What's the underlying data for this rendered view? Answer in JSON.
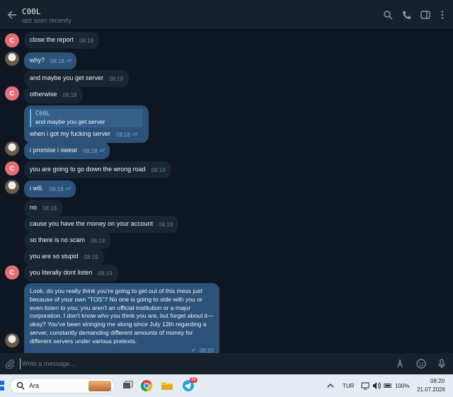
{
  "header": {
    "title": "C00L",
    "status": "last seen recently"
  },
  "messages": [
    {
      "text": "close the report",
      "time": "08:18",
      "sender": "C"
    },
    {
      "text": "why?",
      "time": "08:18",
      "sender": "me",
      "read": "✓✓"
    },
    {
      "text": "and maybe you get server",
      "time": "08:18",
      "sender": "C"
    },
    {
      "text": "otherwise",
      "time": "08:18",
      "sender": "C"
    },
    {
      "quote_name": "C00L",
      "quote_text": "and maybe you get server",
      "text": "when i got my fucking server",
      "time": "08:18",
      "sender": "me",
      "read": "✓✓"
    },
    {
      "text": "i promise i swear",
      "time": "08:18",
      "sender": "me",
      "read": "✓✓"
    },
    {
      "text": "you are going to go down the wrong road",
      "time": "08:18",
      "sender": "C"
    },
    {
      "text": "i will.",
      "time": "08:18",
      "sender": "me",
      "read": "✓✓"
    },
    {
      "text": "no",
      "time": "08:18",
      "sender": "C"
    },
    {
      "text": "cause you have the money on your account",
      "time": "08:18",
      "sender": "C"
    },
    {
      "text": "so there is no scam",
      "time": "08:19",
      "sender": "C"
    },
    {
      "text": "you are so stupid",
      "time": "08:19",
      "sender": "C"
    },
    {
      "text": "you literally dont listen",
      "time": "08:19",
      "sender": "C"
    },
    {
      "text": "Look, do you really think you're going to get out of this mess just because of your own \"TOS\"? No one is going to side with you or even listen to you; you aren't an official institution or a major corporation. I don't know who you think you are, but forget about it—okay? You've been stringing me along since July 13th regarding a server, constantly demanding different amounts of money for different servers under various pretexts.",
      "time": "08:20",
      "sender": "me",
      "read": "✓"
    }
  ],
  "avatar_letter": "C",
  "input": {
    "placeholder": "Write a message..."
  },
  "taskbar": {
    "search_label": "Ara",
    "telegram_badge": "39",
    "language": "TUR",
    "battery": "100%",
    "time": "08:20",
    "date": "21.07.2026"
  },
  "colors": {
    "background": "#0e1621",
    "incoming_bubble": "#182533",
    "outgoing_bubble": "#2b5278",
    "avatar_c": "#e56f79",
    "accent": "#6ab3f3"
  }
}
